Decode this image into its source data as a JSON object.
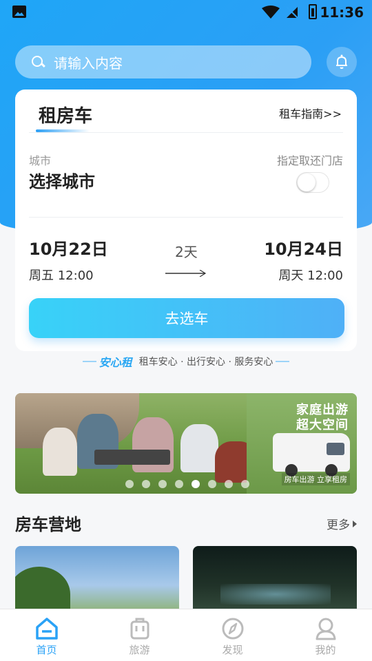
{
  "status_bar": {
    "time": "11:36"
  },
  "search": {
    "placeholder": "请输入内容"
  },
  "card": {
    "title": "租房车",
    "guide_link": "租车指南>>",
    "city_label": "城市",
    "city_value": "选择城市",
    "store_label": "指定取还门店",
    "store_toggle_on": false,
    "start_date": "10月22日",
    "start_time": "周五 12:00",
    "duration": "2天",
    "end_date": "10月24日",
    "end_time": "周天 12:00",
    "cta_label": "去选车"
  },
  "assurance": {
    "brand": "安心租",
    "text": "租车安心 · 出行安心 · 服务安心"
  },
  "banner": {
    "headline_1": "家庭出游",
    "headline_2": "超大空间",
    "footer": "房车出游 立享租房",
    "slide_count": 8,
    "active_slide": 5
  },
  "section": {
    "title": "房车营地",
    "more_label": "更多"
  },
  "tabbar": {
    "items": [
      {
        "label": "首页",
        "icon": "home-icon",
        "active": true
      },
      {
        "label": "旅游",
        "icon": "luggage-icon",
        "active": false
      },
      {
        "label": "发现",
        "icon": "compass-icon",
        "active": false
      },
      {
        "label": "我的",
        "icon": "profile-icon",
        "active": false
      }
    ]
  },
  "colors": {
    "primary": "#2aa2f6",
    "cta_start": "#38d2f8",
    "cta_end": "#4fb0f7"
  }
}
